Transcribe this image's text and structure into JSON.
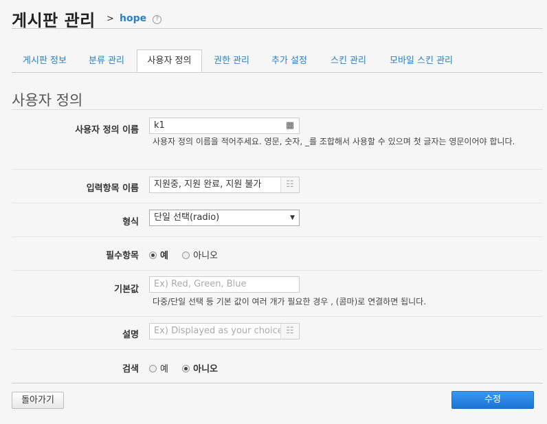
{
  "header": {
    "title": "게시판 관리",
    "crumb_sep": ">",
    "crumb_link": "hope",
    "help_glyph": "?"
  },
  "tabs": [
    {
      "label": "게시판 정보"
    },
    {
      "label": "분류 관리"
    },
    {
      "label": "사용자 정의"
    },
    {
      "label": "권한 관리"
    },
    {
      "label": "추가 설정"
    },
    {
      "label": "스킨 관리"
    },
    {
      "label": "모바일 스킨 관리"
    }
  ],
  "section_title": "사용자 정의",
  "form": {
    "name": {
      "label": "사용자 정의 이름",
      "value": "k1",
      "help": "사용자 정의 이름을 적어주세요. 영문, 숫자, _를 조합해서 사용할 수 있으며 첫 글자는 영문이어야 합니다."
    },
    "item_name": {
      "label": "입력항목 이름",
      "value": "지원중, 지원 완료, 지원 불가"
    },
    "type": {
      "label": "형식",
      "selected": "단일 선택(radio)"
    },
    "required": {
      "label": "필수항목",
      "options": [
        "예",
        "아니오"
      ],
      "selected": "예"
    },
    "default": {
      "label": "기본값",
      "placeholder": "Ex) Red, Green, Blue",
      "help": "다중/단일 선택 등 기본 값이 여러 개가 필요한 경우 , (콤마)로 연결하면 됩니다."
    },
    "description": {
      "label": "설명",
      "placeholder": "Ex) Displayed as your choice"
    },
    "search": {
      "label": "검색",
      "options": [
        "예",
        "아니오"
      ],
      "selected": "아니오"
    }
  },
  "buttons": {
    "back": "돌아가기",
    "submit": "수정"
  },
  "colors": {
    "accent": "#2a7fc7",
    "submit": "#1b74d6"
  }
}
